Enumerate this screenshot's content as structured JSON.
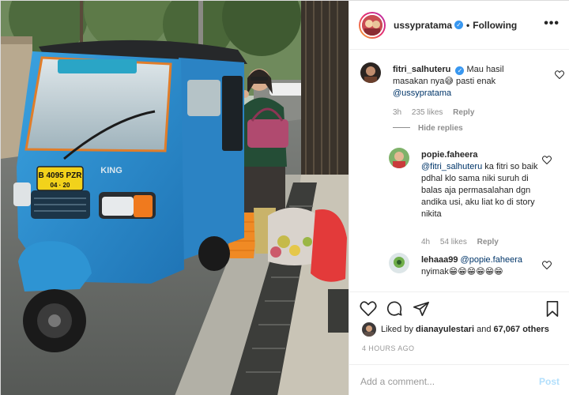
{
  "header": {
    "username": "ussypratama",
    "verified_mark": "✓",
    "separator": "•",
    "follow_status": "Following",
    "more_glyph": "•••"
  },
  "photo": {
    "plate_line1": "B 4095 PZR",
    "plate_line2": "04 · 20",
    "brand_badge": "KING"
  },
  "comments": [
    {
      "user": "fitri_salhuteru",
      "verified_mark": "✓",
      "text": "Mau hasil masakan nya😅 pasti enak",
      "mention": "@ussypratama",
      "time": "3h",
      "likes": "235 likes",
      "reply": "Reply",
      "hide_replies": "Hide replies"
    },
    {
      "user": "popie.faheera",
      "mention": "@fitri_salhuteru",
      "text": "ka fitri so baik pdhal klo sama niki suruh di balas aja permasalahan dgn andika usi, aku liat ko di story nikita",
      "time": "4h",
      "likes": "54 likes",
      "reply": "Reply"
    },
    {
      "user": "lehaaa99",
      "mention": "@popie.faheera",
      "text": "nyimak😁😁😁😁😁😁"
    }
  ],
  "actions": {
    "icons": [
      "heart-icon",
      "comment-icon",
      "share-icon",
      "bookmark-icon"
    ],
    "liked_by_prefix": "Liked by",
    "liked_by_user": "dianayulestari",
    "liked_by_and": "and",
    "likes_count": "67,067 others",
    "timestamp": "4 HOURS AGO"
  },
  "add_comment": {
    "placeholder": "Add a comment...",
    "post_label": "Post"
  },
  "colors": {
    "accent_blue": "#3897f0",
    "mention_blue": "#003569",
    "meta_gray": "#8e8e8e",
    "bajaj_blue": "#2a8fd0"
  }
}
